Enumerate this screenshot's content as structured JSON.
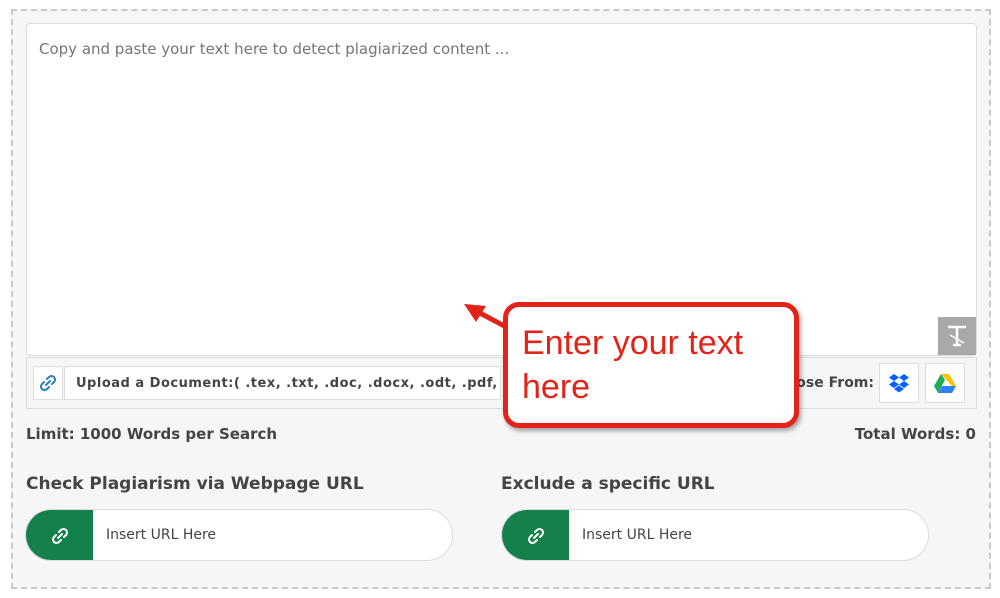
{
  "editor": {
    "placeholder": "Copy and paste your text here to detect plagiarized content ..."
  },
  "upload": {
    "label": "Upload a Document:( .tex, .txt, .doc, .docx, .odt, .pdf, .rtf, .pages )",
    "choose_from": "Choose From:",
    "services": [
      "dropbox-icon",
      "google-drive-icon"
    ]
  },
  "stats": {
    "limit": "Limit: 1000 Words per Search",
    "total_words": "Total Words: 0"
  },
  "webpage_check": {
    "title": "Check Plagiarism via Webpage URL",
    "placeholder": "Insert URL Here"
  },
  "exclude": {
    "title": "Exclude a specific URL",
    "placeholder": "Insert URL Here"
  },
  "annotation": {
    "text": "Enter your text here"
  },
  "colors": {
    "accent_green": "#14804a",
    "annotation_red": "#e2231a",
    "dropbox_blue": "#0061fe"
  }
}
